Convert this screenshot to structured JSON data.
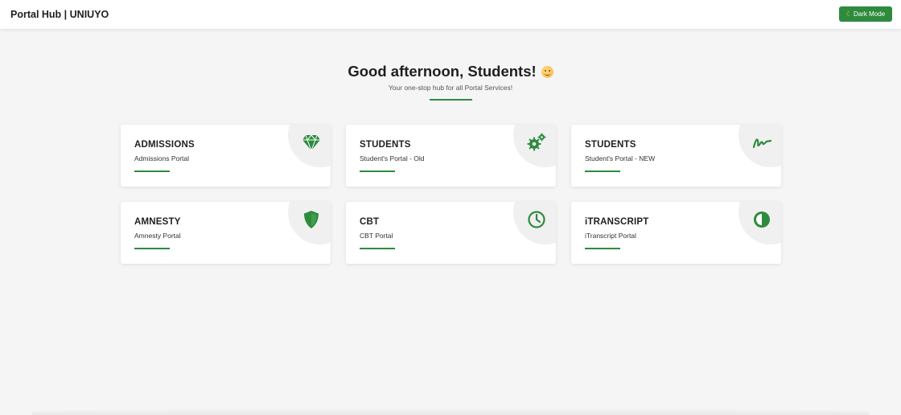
{
  "header": {
    "brand": "Portal Hub | UNIUYO",
    "dark_mode_label": "Dark Mode",
    "dark_mode_icon": "moon-icon"
  },
  "hero": {
    "greeting": "Good afternoon, Students!",
    "greeting_emoji": "smiley-icon",
    "tagline": "Your one-stop hub for all Portal Services!"
  },
  "colors": {
    "accent": "#2e8b3e",
    "card_bg": "#ffffff",
    "page_bg": "#f5f5f5"
  },
  "cards": [
    {
      "title": "ADMISSIONS",
      "subtitle": "Admissions Portal",
      "icon": "diamond-icon"
    },
    {
      "title": "STUDENTS",
      "subtitle": "Student's Portal - Old",
      "icon": "gears-icon"
    },
    {
      "title": "STUDENTS",
      "subtitle": "Student's Portal - NEW",
      "icon": "signature-icon"
    },
    {
      "title": "AMNESTY",
      "subtitle": "Amnesty Portal",
      "icon": "shield-icon"
    },
    {
      "title": "CBT",
      "subtitle": "CBT Portal",
      "icon": "clock-icon"
    },
    {
      "title": "iTRANSCRIPT",
      "subtitle": "iTranscript Portal",
      "icon": "half-circle-icon"
    }
  ]
}
